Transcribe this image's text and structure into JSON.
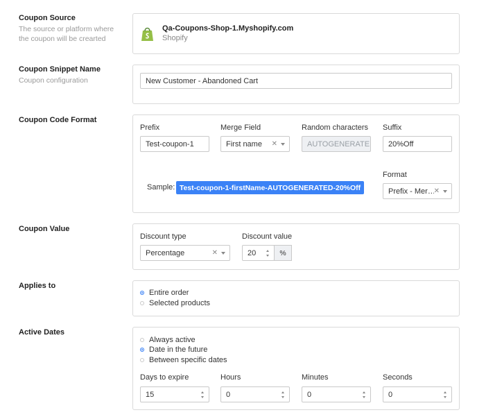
{
  "coupon_source": {
    "title": "Coupon Source",
    "description": "The source or platform where the coupon will be crearted",
    "shop_name": "Qa-Coupons-Shop-1.Myshopify.com",
    "platform": "Shopify",
    "icon": "shopify-bag-icon",
    "brand_color": "#95BF47"
  },
  "coupon_snippet_name": {
    "title": "Coupon Snippet Name",
    "description": "Coupon configuration",
    "value": "New Customer - Abandoned Cart"
  },
  "coupon_code_format": {
    "title": "Coupon Code Format",
    "prefix_label": "Prefix",
    "prefix_value": "Test-coupon-1",
    "merge_field_label": "Merge Field",
    "merge_field_value": "First name",
    "random_label": "Random characters",
    "random_value": "AUTOGENERATEI",
    "suffix_label": "Suffix",
    "suffix_value": "20%Off",
    "sample_label": "Sample:",
    "sample_value": "Test-coupon-1-firstName-AUTOGENERATED-20%Off",
    "sample_color": "#3b82f6",
    "format_label": "Format",
    "format_value": "Prefix - Mer…"
  },
  "coupon_value": {
    "title": "Coupon Value",
    "discount_type_label": "Discount type",
    "discount_type_value": "Percentage",
    "discount_value_label": "Discount value",
    "discount_value": "20",
    "unit": "%"
  },
  "applies_to": {
    "title": "Applies to",
    "options": [
      "Entire order",
      "Selected products"
    ],
    "selected": "Entire order"
  },
  "active_dates": {
    "title": "Active Dates",
    "options": [
      "Always active",
      "Date in the future",
      "Between specific dates"
    ],
    "selected": "Date in the future",
    "days_label": "Days to expire",
    "days_value": "15",
    "hours_label": "Hours",
    "hours_value": "0",
    "minutes_label": "Minutes",
    "minutes_value": "0",
    "seconds_label": "Seconds",
    "seconds_value": "0"
  }
}
